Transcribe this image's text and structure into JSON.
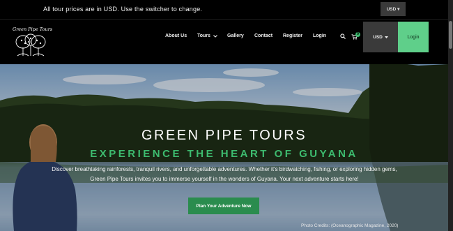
{
  "topbar": {
    "notice": "All tour prices are in USD. Use the switcher to change.",
    "currency": "USD ▾"
  },
  "header": {
    "logo_text": "Green Pipe Tours",
    "nav": [
      "About Us",
      "Tours",
      "Gallery",
      "Contact",
      "Register",
      "Login"
    ],
    "cart_count": "0",
    "currency": "USD",
    "login_button": "Login"
  },
  "hero": {
    "title": "GREEN PIPE TOURS",
    "subtitle": "EXPERIENCE THE HEART OF GUYANA",
    "description": "Discover breathtaking rainforests, tranquil rivers, and unforgettable adventures. Whether it's birdwatching, fishing, or exploring hidden gems, Green Pipe Tours invites you to immerse yourself in the wonders of Guyana. Your next adventure starts here!",
    "cta": "Plan Your Adventure Now",
    "credit": "Photo Credits: (Oceanographic Magazine, 2020)"
  },
  "colors": {
    "accent": "#3dbb6f",
    "cta": "#2a8c4e",
    "login_bg": "#5fcf8a"
  }
}
